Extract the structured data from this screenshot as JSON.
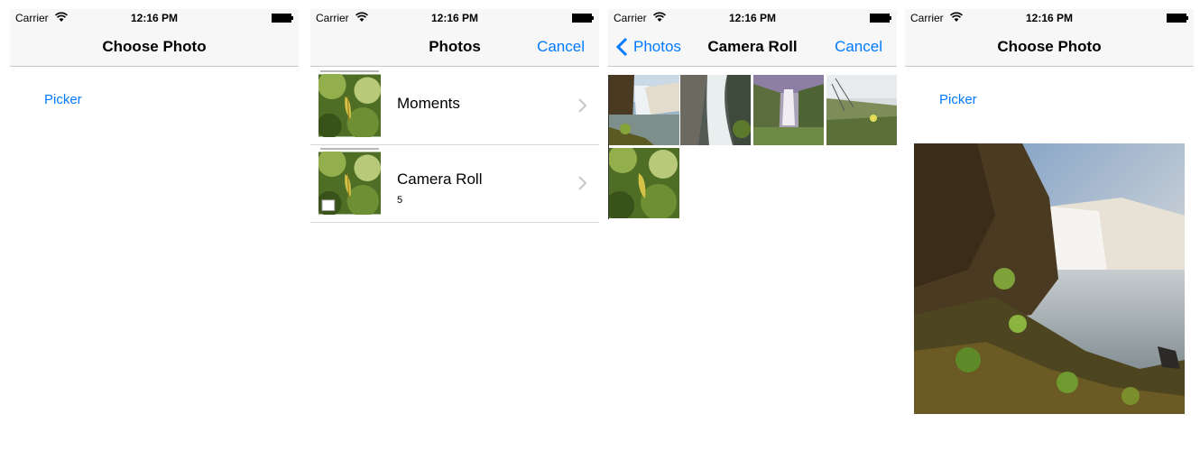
{
  "status_bar": {
    "carrier": "Carrier",
    "time": "12:16 PM"
  },
  "screen1": {
    "nav_title": "Choose Photo",
    "picker_label": "Picker"
  },
  "screen2": {
    "nav_title": "Photos",
    "cancel_label": "Cancel",
    "albums": [
      {
        "name": "Moments",
        "count": ""
      },
      {
        "name": "Camera Roll",
        "count": "5"
      }
    ]
  },
  "screen3": {
    "back_label": "Photos",
    "nav_title": "Camera Roll",
    "cancel_label": "Cancel",
    "photos": [
      "waterfall-photo",
      "cascade-photo",
      "falls-valley-photo",
      "meadow-flower-photo",
      "leaf-photo"
    ]
  },
  "screen4": {
    "nav_title": "Choose Photo",
    "picker_label": "Picker",
    "selected_photo": "waterfall-photo"
  },
  "colors": {
    "accent": "#007aff",
    "bar": "#f7f7f7",
    "separator": "#c8c7cc"
  }
}
